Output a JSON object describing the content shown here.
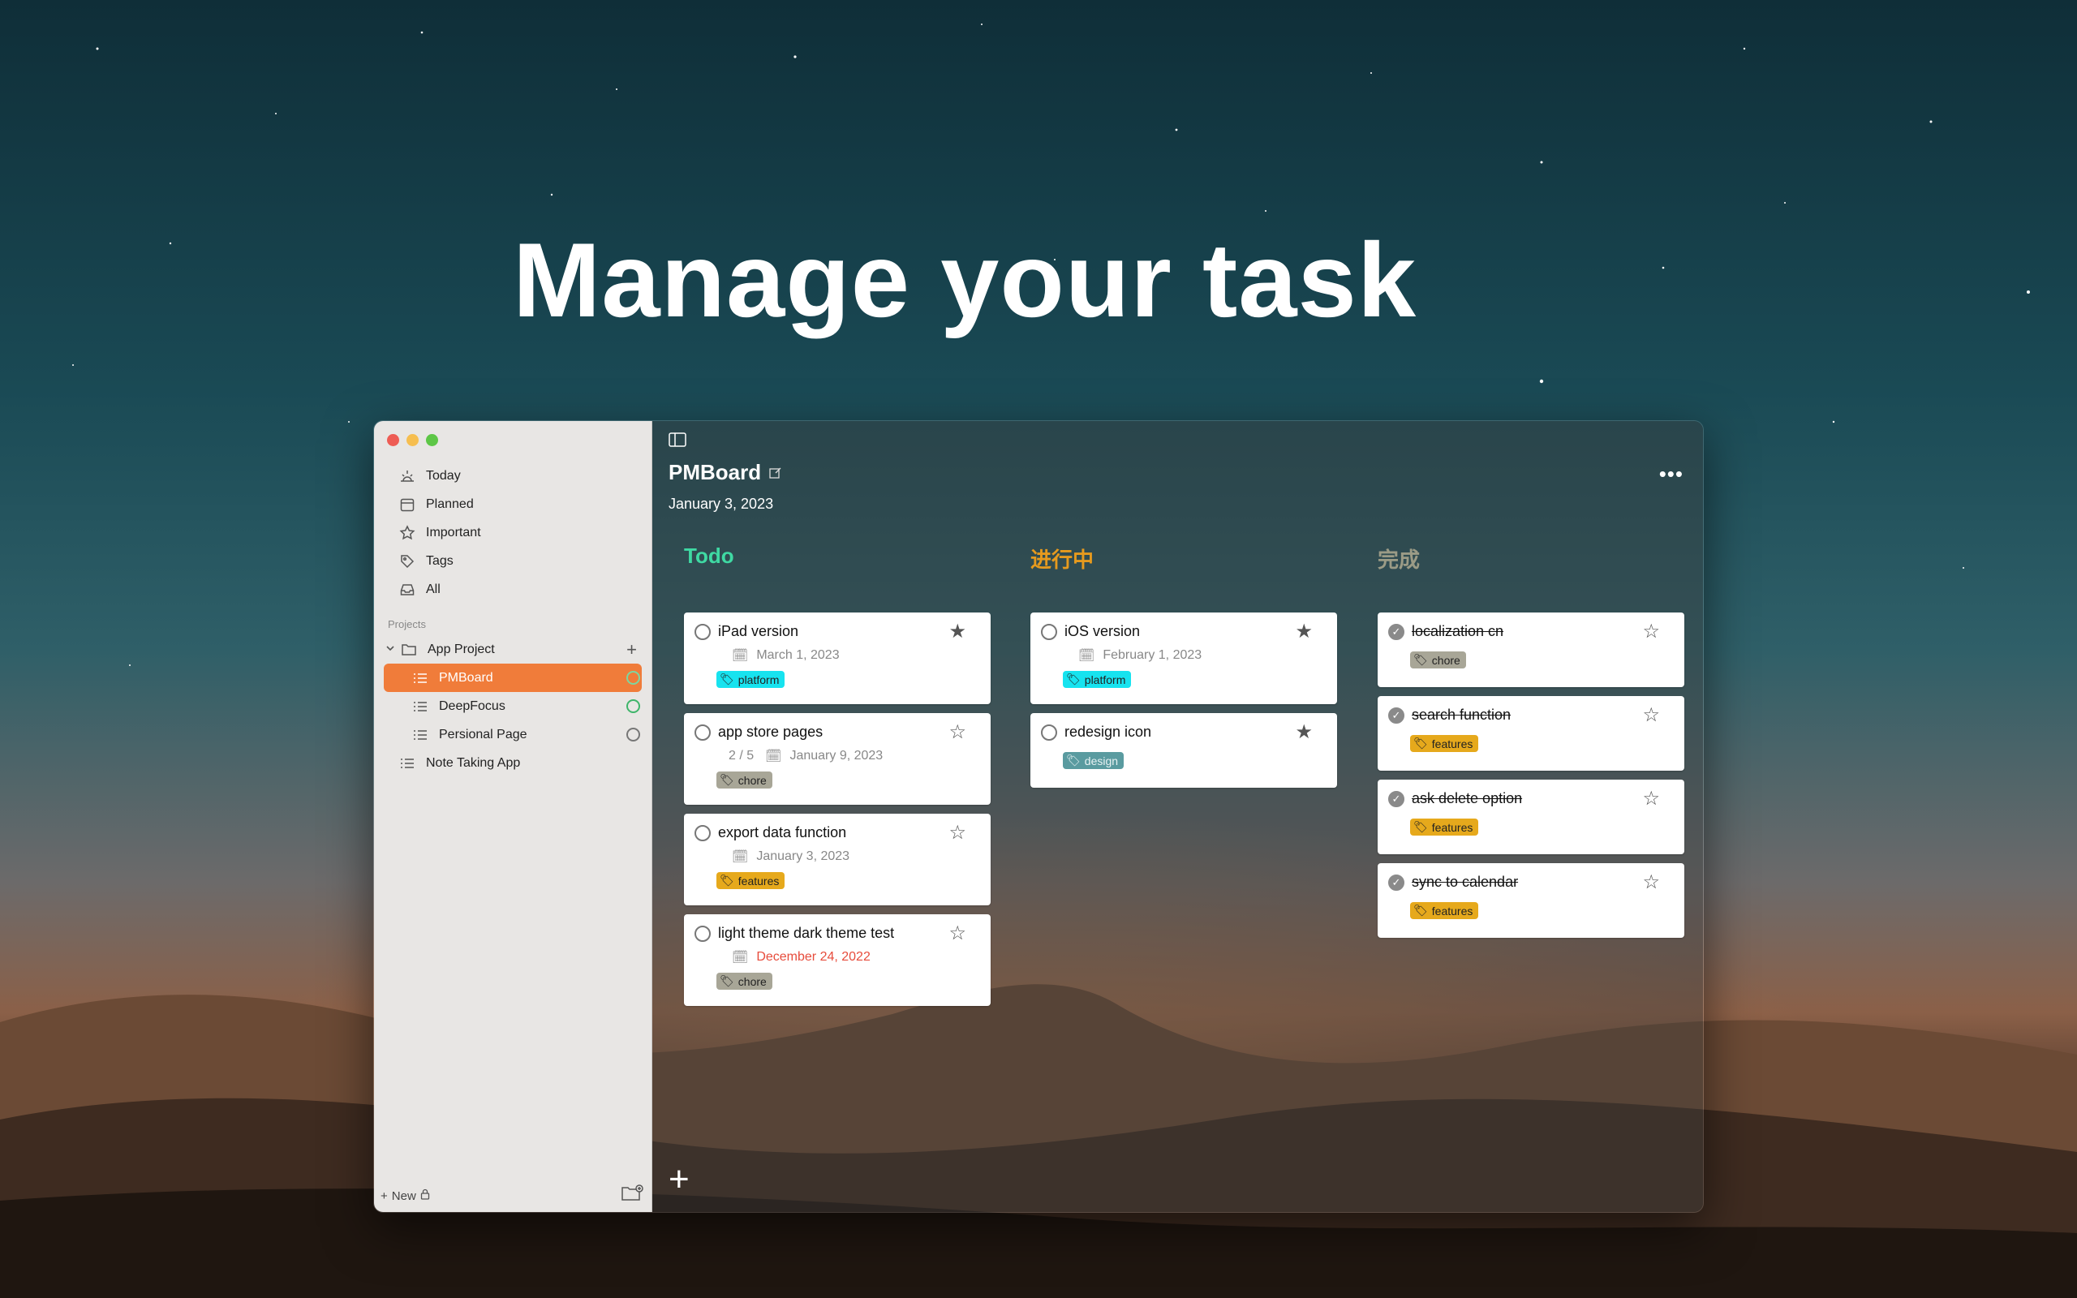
{
  "headline": "Manage your task",
  "colors": {
    "accent": "#f07c3a",
    "todo": "#3fd9a3",
    "in_progress": "#e69a1e",
    "done": "#9b9b86"
  },
  "sidebar": {
    "nav": [
      {
        "label": "Today",
        "icon": "sunrise-icon"
      },
      {
        "label": "Planned",
        "icon": "calendar-icon"
      },
      {
        "label": "Important",
        "icon": "star-icon"
      },
      {
        "label": "Tags",
        "icon": "tag-icon"
      },
      {
        "label": "All",
        "icon": "inbox-icon"
      }
    ],
    "projects_label": "Projects",
    "projects": {
      "group": "App Project",
      "children": [
        "PMBoard",
        "DeepFocus",
        "Persional Page"
      ],
      "other": "Note Taking App"
    },
    "footer_new": "New"
  },
  "board": {
    "title": "PMBoard",
    "date": "January 3, 2023",
    "columns": [
      {
        "title": "Todo"
      },
      {
        "title": "进行中"
      },
      {
        "title": "完成"
      }
    ],
    "todo_cards": [
      {
        "title": "iPad version",
        "date": "March 1, 2023",
        "tag": "platform"
      },
      {
        "title": "app store pages",
        "progress": "2 / 5",
        "date": "January 9, 2023",
        "tag": "chore"
      },
      {
        "title": "export data function",
        "date": "January 3, 2023",
        "tag": "features"
      },
      {
        "title": "light theme dark theme test",
        "date": "December 24, 2022",
        "tag": "chore"
      }
    ],
    "progress_cards": [
      {
        "title": "iOS version",
        "date": "February 1, 2023",
        "tag": "platform"
      },
      {
        "title": "redesign icon",
        "tag": "design"
      }
    ],
    "done_cards": [
      {
        "title": "localization cn",
        "tag": "chore"
      },
      {
        "title": "search function",
        "tag": "features"
      },
      {
        "title": "ask delete option",
        "tag": "features"
      },
      {
        "title": "sync to calendar",
        "tag": "features"
      }
    ]
  }
}
